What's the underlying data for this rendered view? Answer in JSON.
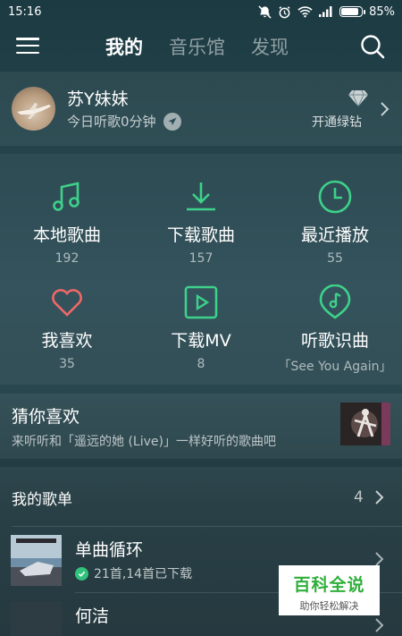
{
  "status_bar": {
    "time": "15:16",
    "battery": "85%",
    "battery_level": 0.85
  },
  "nav": {
    "tabs": [
      {
        "label": "我的",
        "active": true
      },
      {
        "label": "音乐馆",
        "active": false
      },
      {
        "label": "发现",
        "active": false
      }
    ]
  },
  "profile": {
    "username": "苏Y妹妹",
    "listen_time": "今日听歌0分钟",
    "vip_label": "开通绿钻"
  },
  "quick_grid": [
    {
      "label": "本地歌曲",
      "count": "192",
      "icon": "music-note-icon"
    },
    {
      "label": "下载歌曲",
      "count": "157",
      "icon": "download-icon"
    },
    {
      "label": "最近播放",
      "count": "55",
      "icon": "clock-icon"
    },
    {
      "label": "我喜欢",
      "count": "35",
      "icon": "heart-icon"
    },
    {
      "label": "下载MV",
      "count": "8",
      "icon": "play-box-icon"
    },
    {
      "label": "听歌识曲",
      "count": "「See You Again」",
      "icon": "music-recognize-icon"
    }
  ],
  "guess": {
    "title": "猜你喜欢",
    "subtitle": "来听听和「遥远的她 (Live)」一样好听的歌曲吧"
  },
  "playlists": {
    "header": "我的歌单",
    "count": "4",
    "items": [
      {
        "name": "单曲循环",
        "info": "21首,14首已下载"
      },
      {
        "name": "何洁",
        "info": ""
      }
    ]
  },
  "watermark": {
    "title": "百科全说",
    "subtitle": "助你轻松解决"
  },
  "colors": {
    "accent": "#31c27c",
    "icon_green": "#3ed18a",
    "heart": "#f06868"
  }
}
